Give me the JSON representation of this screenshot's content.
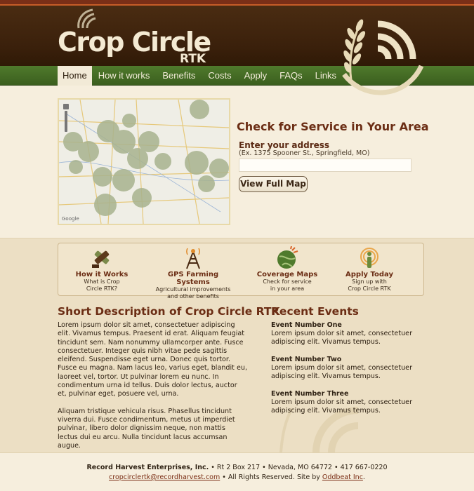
{
  "header": {
    "logo_text": "Crop Circle",
    "logo_sub": "RTK"
  },
  "nav": {
    "items": [
      "Home",
      "How it works",
      "Benefits",
      "Costs",
      "Apply",
      "FAQs",
      "Links"
    ]
  },
  "hero": {
    "title": "Check for Service in Your Area",
    "address_label": "Enter your address",
    "address_hint": "(Ex. 1375 Spooner St., Springfield, MO)",
    "address_value": "",
    "button_label": "View Full Map"
  },
  "features": [
    {
      "icon": "tools-icon",
      "title": "How it Works",
      "desc1": "What is Crop",
      "desc2": "Circle RTK?"
    },
    {
      "icon": "gps-tower-icon",
      "title": "GPS Farming Systems",
      "desc1": "Agricultural improvements",
      "desc2": "and other benefits"
    },
    {
      "icon": "globe-icon",
      "title": "Coverage Maps",
      "desc1": "Check for service",
      "desc2": "in your area"
    },
    {
      "icon": "signal-person-icon",
      "title": "Apply Today",
      "desc1": "Sign up with",
      "desc2": "Crop Circle RTK"
    }
  ],
  "description": {
    "title": "Short Description of Crop Circle RTK",
    "para1": "Lorem ipsum dolor sit amet, consectetuer adipiscing elit. Vivamus tempus. Praesent id erat. Aliquam feugiat tincidunt sem. Nam nonummy ullamcorper ante. Fusce consectetuer. Integer quis nibh vitae pede sagittis eleifend. Suspendisse eget urna. Donec quis tortor. Fusce eu magna. Nam lacus leo, varius eget, blandit eu, laoreet vel, tortor. Ut pulvinar lorem eu nunc. In condimentum urna id tellus. Duis dolor lectus, auctor et, pulvinar eget, posuere vel, urna.",
    "para2": "Aliquam tristique vehicula risus. Phasellus tincidunt viverra dui. Fusce condimentum, metus ut imperdiet pulvinar, libero dolor dignissim neque, non mattis lectus dui eu arcu. Nulla tincidunt lacus accumsan augue."
  },
  "events": {
    "title": "Recent Events",
    "items": [
      {
        "name": "Event Number One",
        "text": "Lorem ipsum dolor sit amet, consectetuer adipiscing elit. Vivamus tempus."
      },
      {
        "name": "Event Number Two",
        "text": "Lorem ipsum dolor sit amet, consectetuer adipiscing elit. Vivamus tempus."
      },
      {
        "name": "Event Number Three",
        "text": "Lorem ipsum dolor sit amet, consectetuer adipiscing elit. Vivamus tempus."
      }
    ]
  },
  "footer": {
    "company": "Record Harvest Enterprises, Inc.",
    "address": " • Rt 2 Box 217 • Nevada, MO 64772 • 417 667-0220",
    "email": "cropcirclertk@recordharvest.com",
    "rights": " • All Rights Reserved. Site by ",
    "site_by": "Oddbeat Inc",
    "end": "."
  },
  "map": {
    "attribution": "Google"
  },
  "colors": {
    "brown_dark": "#3a200b",
    "green_nav": "#4f7a2c",
    "title_red": "#6b2d14",
    "cream": "#efe5cf"
  }
}
